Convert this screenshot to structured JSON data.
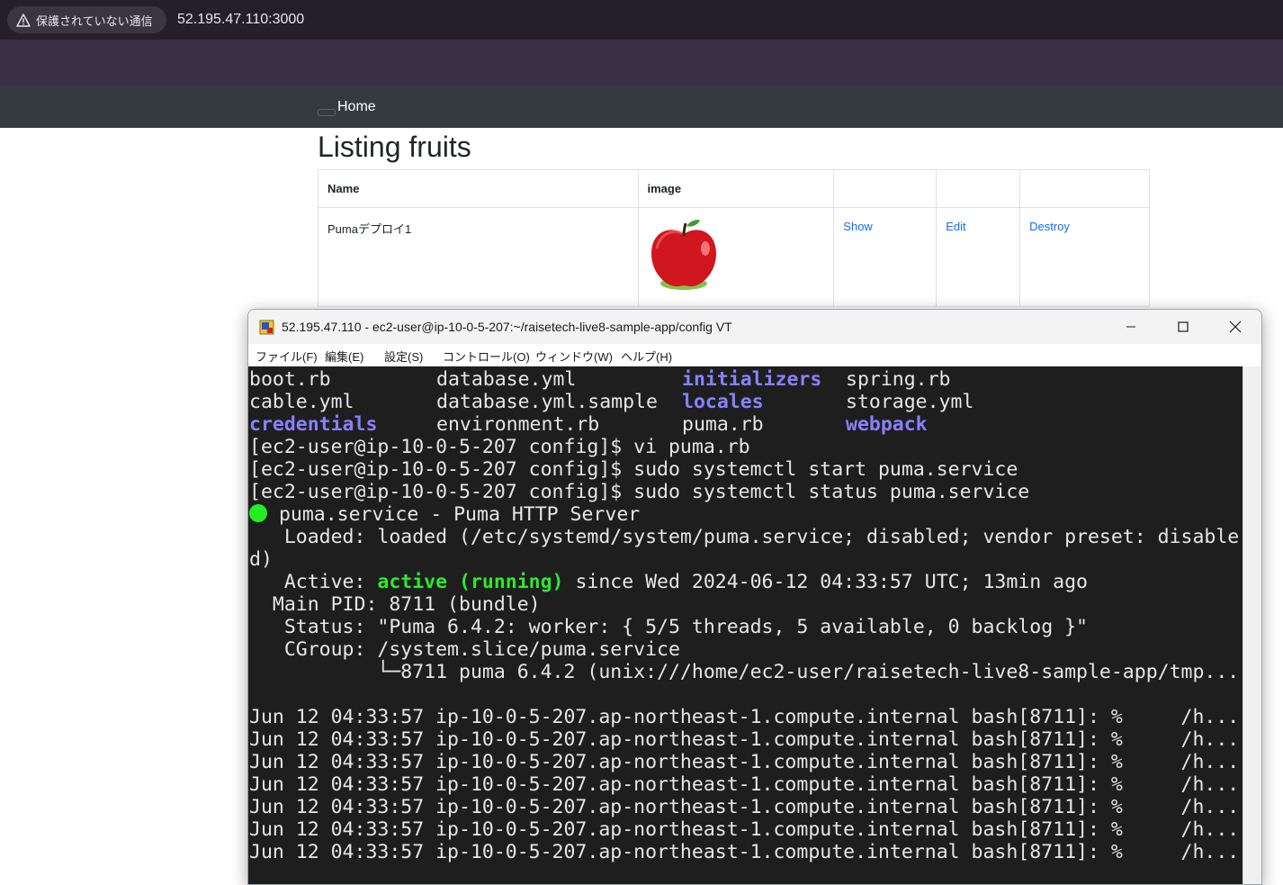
{
  "browser": {
    "security_label": "保護されていない通信",
    "url": "52.195.47.110:3000"
  },
  "nav": {
    "home": "Home"
  },
  "page": {
    "title": "Listing fruits",
    "headers": [
      "Name",
      "image",
      "",
      "",
      ""
    ],
    "rows": [
      {
        "name": "Pumaデプロイ1",
        "image": "apple",
        "show": "Show",
        "edit": "Edit",
        "destroy": "Destroy"
      }
    ]
  },
  "terminal": {
    "title": "52.195.47.110 - ec2-user@ip-10-0-5-207:~/raisetech-live8-sample-app/config VT",
    "menu": [
      "ファイル(F)",
      "編集(E)",
      "設定(S)",
      "コントロール(O)",
      "ウィンドウ(W)",
      "ヘルプ(H)"
    ],
    "ls": [
      [
        "boot.rb",
        "database.yml",
        "initializers",
        "spring.rb"
      ],
      [
        "cable.yml",
        "database.yml.sample",
        "locales",
        "storage.yml"
      ],
      [
        "credentials",
        "environment.rb",
        "puma.rb",
        "webpack"
      ]
    ],
    "prompts": [
      "[ec2-user@ip-10-0-5-207 config]$ vi puma.rb",
      "[ec2-user@ip-10-0-5-207 config]$ sudo systemctl start puma.service",
      "[ec2-user@ip-10-0-5-207 config]$ sudo systemctl status puma.service"
    ],
    "service_line": " puma.service - Puma HTTP Server",
    "loaded_1": "   Loaded: loaded (/etc/systemd/system/puma.service; disabled; vendor preset: disable",
    "loaded_2": "d)",
    "active_prefix": "   Active: ",
    "active_state": "active (running)",
    "active_suffix": " since Wed 2024-06-12 04:33:57 UTC; 13min ago",
    "main_pid": "  Main PID: 8711 (bundle)",
    "status": "   Status: \"Puma 6.4.2: worker: { 5/5 threads, 5 available, 0 backlog }\"",
    "cgroup": "   CGroup: /system.slice/puma.service",
    "cgroup_child": "           └─8711 puma 6.4.2 (unix:///home/ec2-user/raisetech-live8-sample-app/tmp...",
    "journal": [
      "Jun 12 04:33:57 ip-10-0-5-207.ap-northeast-1.compute.internal bash[8711]: %     /h...",
      "Jun 12 04:33:57 ip-10-0-5-207.ap-northeast-1.compute.internal bash[8711]: %     /h...",
      "Jun 12 04:33:57 ip-10-0-5-207.ap-northeast-1.compute.internal bash[8711]: %     /h...",
      "Jun 12 04:33:57 ip-10-0-5-207.ap-northeast-1.compute.internal bash[8711]: %     /h...",
      "Jun 12 04:33:57 ip-10-0-5-207.ap-northeast-1.compute.internal bash[8711]: %     /h...",
      "Jun 12 04:33:57 ip-10-0-5-207.ap-northeast-1.compute.internal bash[8711]: %     /h...",
      "Jun 12 04:33:57 ip-10-0-5-207.ap-northeast-1.compute.internal bash[8711]: %     /h..."
    ]
  }
}
